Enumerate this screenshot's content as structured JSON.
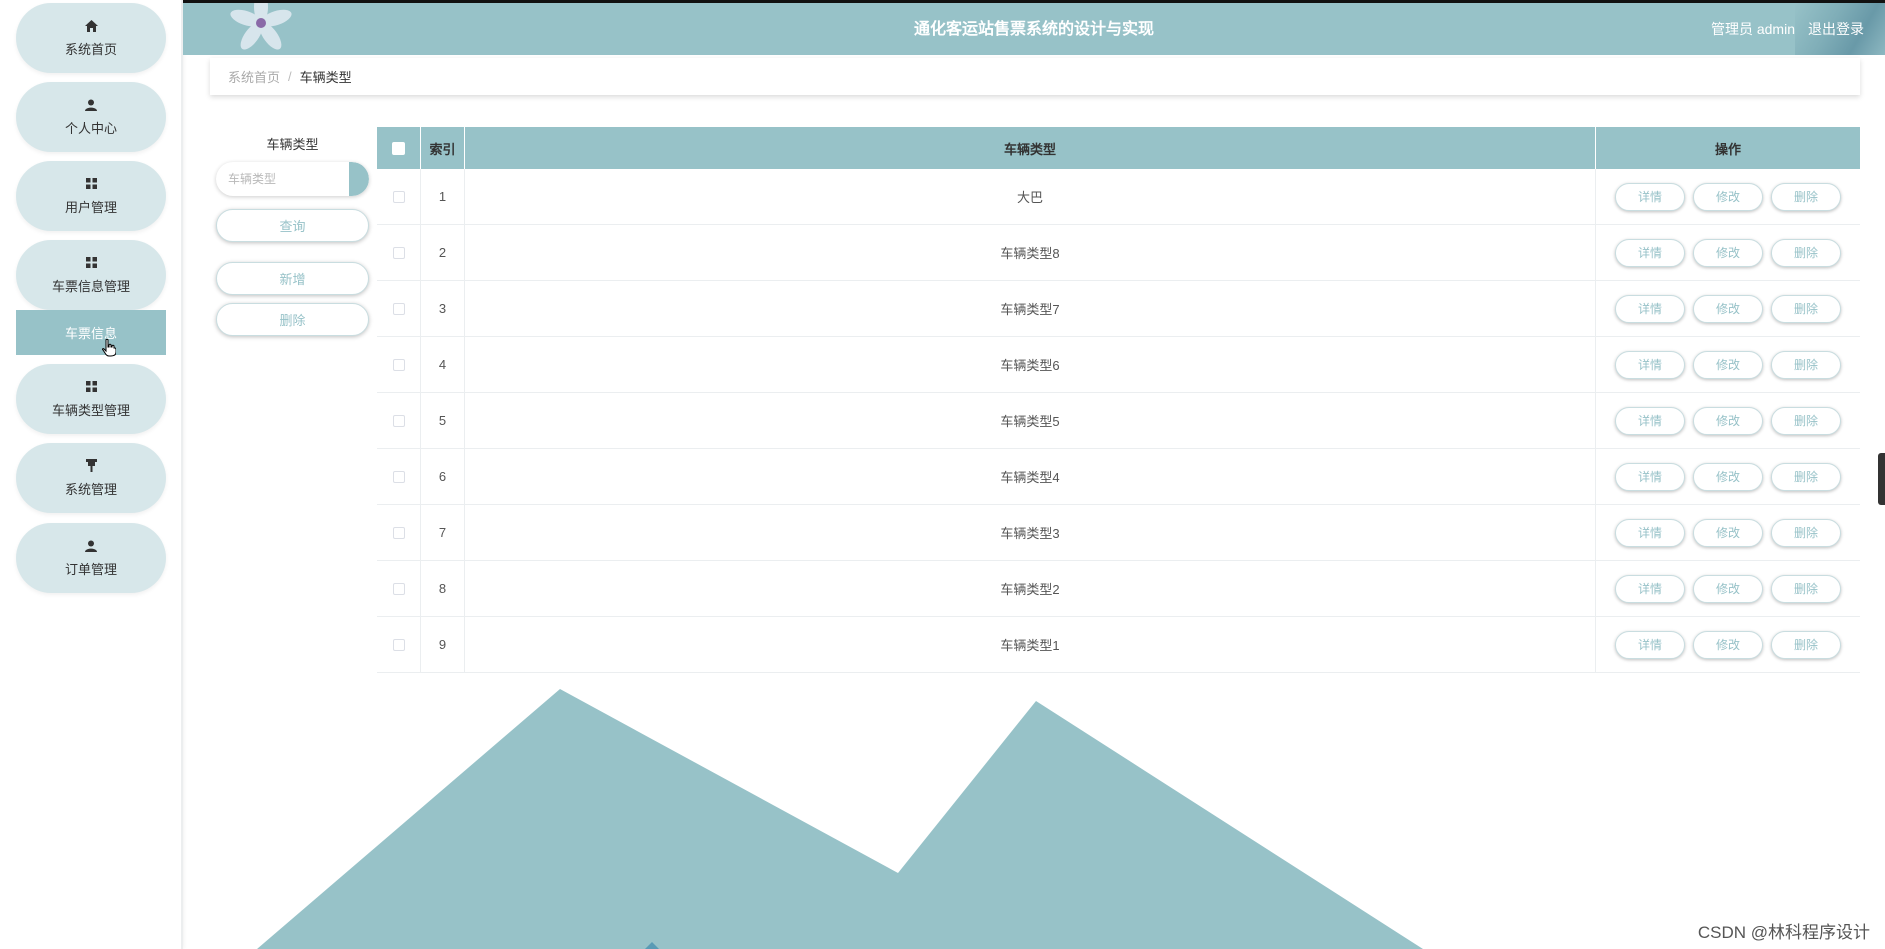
{
  "header": {
    "title": "通化客运站售票系统的设计与实现",
    "user": "管理员 admin",
    "logout": "退出登录"
  },
  "sidebar": {
    "items": [
      {
        "label": "系统首页",
        "icon": "home-icon"
      },
      {
        "label": "个人中心",
        "icon": "user-icon"
      },
      {
        "label": "用户管理",
        "icon": "grid-icon"
      },
      {
        "label": "车票信息管理",
        "icon": "grid-icon"
      },
      {
        "label": "车辆类型管理",
        "icon": "grid-icon"
      },
      {
        "label": "系统管理",
        "icon": "thumbtack-icon"
      },
      {
        "label": "订单管理",
        "icon": "user-icon"
      }
    ],
    "active_sub": "车票信息"
  },
  "breadcrumb": {
    "home": "系统首页",
    "separator": "/",
    "current": "车辆类型"
  },
  "search": {
    "label": "车辆类型",
    "placeholder": "车辆类型",
    "query_button": "查询",
    "add_button": "新增",
    "delete_button": "删除"
  },
  "table": {
    "headers": {
      "index": "索引",
      "type": "车辆类型",
      "ops": "操作"
    },
    "rows": [
      {
        "index": "1",
        "type": "大巴"
      },
      {
        "index": "2",
        "type": "车辆类型8"
      },
      {
        "index": "3",
        "type": "车辆类型7"
      },
      {
        "index": "4",
        "type": "车辆类型6"
      },
      {
        "index": "5",
        "type": "车辆类型5"
      },
      {
        "index": "6",
        "type": "车辆类型4"
      },
      {
        "index": "7",
        "type": "车辆类型3"
      },
      {
        "index": "8",
        "type": "车辆类型2"
      },
      {
        "index": "9",
        "type": "车辆类型1"
      }
    ],
    "op_labels": {
      "detail": "详情",
      "edit": "修改",
      "delete": "删除"
    }
  },
  "watermark": "CSDN @林科程序设计",
  "colors": {
    "accent": "#97c2c8",
    "pill": "#d7e7ea"
  }
}
